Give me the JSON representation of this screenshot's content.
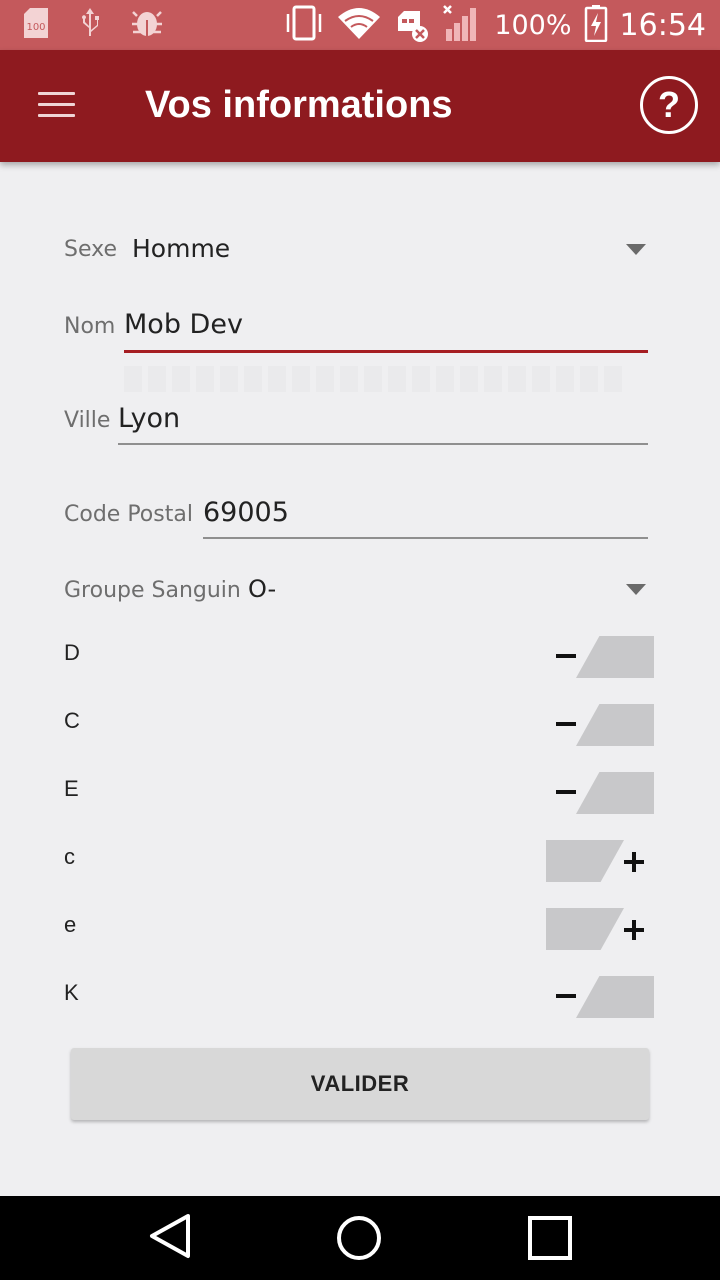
{
  "status_bar": {
    "icons_left": [
      "sd-card-icon",
      "usb-icon",
      "android-debug-icon"
    ],
    "icons_right": [
      "vibrate-icon",
      "wifi-icon",
      "sim-error-icon",
      "signal-icon",
      "battery-charging-icon"
    ],
    "battery_text": "100%",
    "time": "16:54",
    "battery_small_label": "100"
  },
  "app_bar": {
    "title": "Vos informations",
    "help_label": "?",
    "color": "#8e1a1f"
  },
  "form": {
    "sexe": {
      "label": "Sexe",
      "value": "Homme"
    },
    "nom": {
      "label": "Nom",
      "value": "Mob Dev"
    },
    "ville": {
      "label": "Ville",
      "value": "Lyon"
    },
    "code_postal": {
      "label": "Code Postal",
      "value": "69005"
    },
    "groupe_sanguin": {
      "label": "Groupe Sanguin",
      "value": "O-"
    }
  },
  "rhesus": [
    {
      "label": "D",
      "state": "negative"
    },
    {
      "label": "C",
      "state": "negative"
    },
    {
      "label": "E",
      "state": "negative"
    },
    {
      "label": "c",
      "state": "positive"
    },
    {
      "label": "e",
      "state": "positive"
    },
    {
      "label": "K",
      "state": "negative"
    }
  ],
  "submit_label": "VALIDER",
  "nav": [
    "back-icon",
    "home-icon",
    "recents-icon"
  ]
}
